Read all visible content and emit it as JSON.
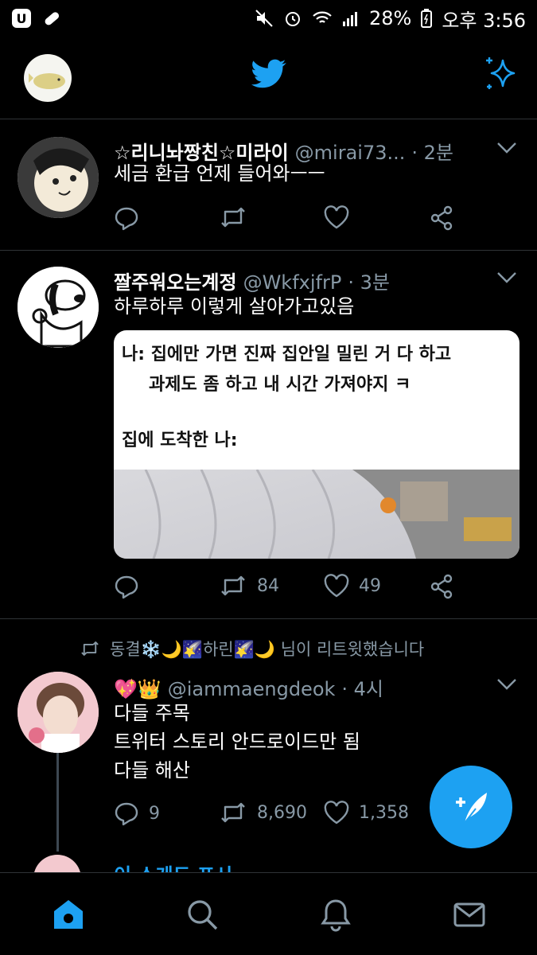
{
  "status_bar": {
    "battery": "28%",
    "time": "오후 3:56"
  },
  "colors": {
    "accent": "#1da1f2",
    "background": "#000000",
    "secondary_text": "#8899a6",
    "divider": "#2f3336"
  },
  "header": {
    "logo_icon": "twitter-bird-icon",
    "right_icon": "sparkle-icon"
  },
  "tweets": [
    {
      "name": "☆리니놔짱친☆미라이",
      "handle": "@mirai73...",
      "time": "· 2분",
      "text": "세금 환급 언제 들어와ㅡㅡ",
      "reply_count": "",
      "retweet_count": "",
      "like_count": ""
    },
    {
      "name": "짤주워오는계정",
      "handle": "@WkfxjfrP",
      "time": "· 3분",
      "text": "하루하루 이렇게 살아가고있음",
      "media_lines": [
        "나: 집에만 가면 진짜 집안일 밀린 거 다 하고",
        "과제도 좀 하고 내 시간 가져야지 ㅋ",
        "집에 도착한 나:"
      ],
      "reply_count": "",
      "retweet_count": "84",
      "like_count": "49"
    },
    {
      "retweeted_by": "동결❄️🌙🌠하린🌠🌙 님이 리트윗했습니다",
      "name": "💖👑",
      "handle": "@iammaengdeok",
      "time": "· 4시",
      "lines": [
        "다들 주목",
        "트위터 스토리 안드로이드만 됨",
        "다들 해산"
      ],
      "reply_count": "9",
      "retweet_count": "8,690",
      "like_count": "1,358"
    }
  ],
  "next_tweet_partial": "이 스게도 포시",
  "compose_button": "compose-tweet-icon",
  "bottom_nav": [
    "home-icon",
    "search-icon",
    "notifications-icon",
    "messages-icon"
  ]
}
